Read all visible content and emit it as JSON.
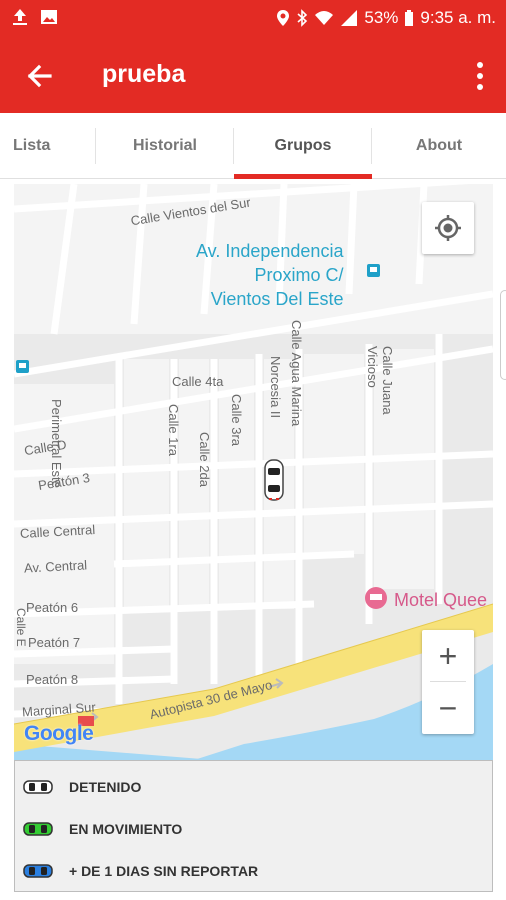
{
  "status_bar": {
    "battery_percent": "53%",
    "time": "9:35 a. m."
  },
  "app_bar": {
    "title": "prueba"
  },
  "tabs": [
    {
      "label": "Lista",
      "active": false
    },
    {
      "label": "Historial",
      "active": false
    },
    {
      "label": "Grupos",
      "active": true
    },
    {
      "label": "About",
      "active": false
    }
  ],
  "map": {
    "streets": {
      "calle_vientos_del_sur": "Calle Vientos del Sur",
      "perimetral_este": "Perimetral Este",
      "calle_4ta": "Calle 4ta",
      "calle_1ra": "Calle 1ra",
      "calle_2da": "Calle 2da",
      "calle_3ra": "Calle 3ra",
      "norcesia_ii": "Norcesia II",
      "calle_agua_marina": "Calle Agua Marina",
      "calle_juana_vicioso": "Calle Juana Vicioso",
      "calle_d": "Calle D",
      "peaton_3": "Peatón 3",
      "calle_central": "Calle Central",
      "av_central": "Av. Central",
      "peaton_6": "Peatón 6",
      "peaton_7": "Peatón 7",
      "peaton_8": "Peatón 8",
      "calle_e": "Calle E",
      "marginal_sur": "Marginal Sur",
      "autopista": "Autopista 30 de Mayo"
    },
    "poi": {
      "bus_stop_line1": "Av. Independencia",
      "bus_stop_line2": "Proximo C/",
      "bus_stop_line3": "Vientos Del Este",
      "motel": "Motel Quee"
    },
    "brand": "Google",
    "zoom_in": "+",
    "zoom_out": "−"
  },
  "legend": [
    {
      "label": "DETENIDO",
      "color": "#ffffff"
    },
    {
      "label": "EN MOVIMIENTO",
      "color": "#33cc33"
    },
    {
      "label": "+ DE 1 DIAS SIN REPORTAR",
      "color": "#2a7fe0"
    }
  ]
}
